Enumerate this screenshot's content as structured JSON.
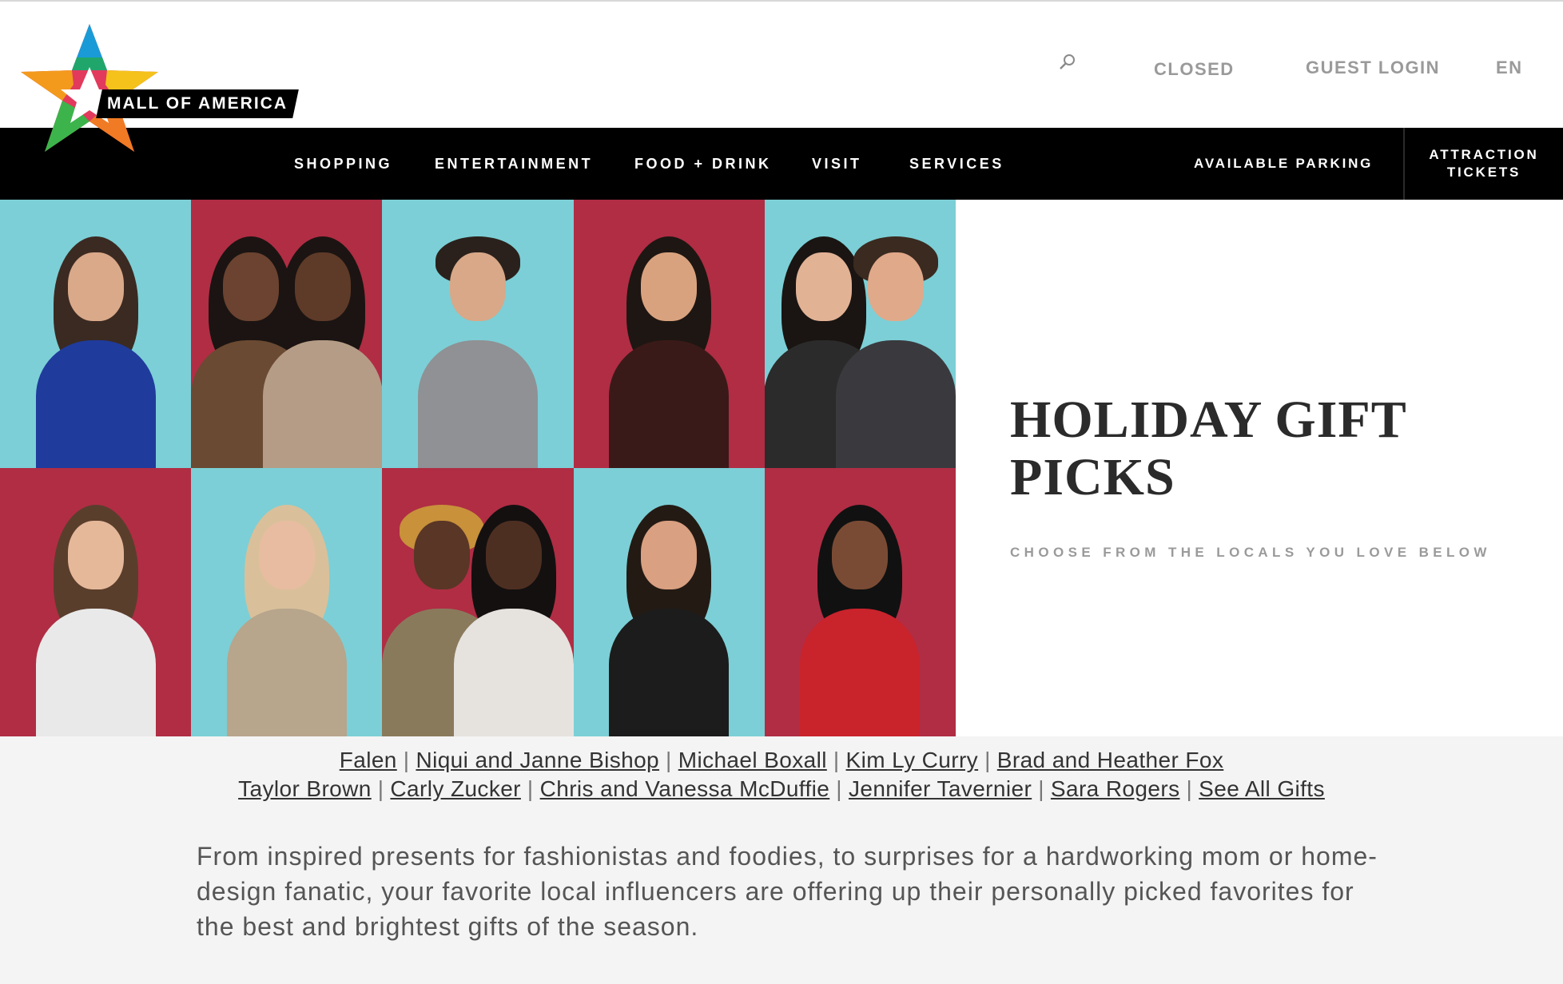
{
  "brand": {
    "name": "MALL OF AMERICA"
  },
  "utility": {
    "search_icon": "search-icon",
    "status": "CLOSED",
    "login": "GUEST LOGIN",
    "language": "EN"
  },
  "nav": {
    "items": [
      {
        "label": "SHOPPING"
      },
      {
        "label": "ENTERTAINMENT"
      },
      {
        "label": "FOOD + DRINK"
      },
      {
        "label": "VISIT"
      },
      {
        "label": "SERVICES"
      }
    ],
    "parking": "AVAILABLE PARKING",
    "tickets": "ATTRACTION TICKETS"
  },
  "hero": {
    "title": "HOLIDAY GIFT PICKS",
    "subtitle": "CHOOSE FROM THE LOCALS YOU LOVE BELOW"
  },
  "influencers": {
    "row1": [
      "Falen",
      "Niqui and Janne Bishop",
      "Michael Boxall",
      "Kim Ly Curry",
      "Brad and Heather Fox"
    ],
    "row2": [
      "Taylor Brown",
      "Carly Zucker",
      "Chris and Vanessa McDuffie",
      "Jennifer Tavernier",
      "Sara Rogers",
      "See All Gifts"
    ]
  },
  "intro": "From inspired presents for fashionistas and foodies, to surprises for a hardworking mom or home-design fanatic, your favorite local influencers are offering up their personally picked favorites for the best and brightest gifts of the season.",
  "colors": {
    "accent_black": "#000000",
    "tile_teal": "#7ccfd6",
    "tile_red": "#b02d44"
  }
}
